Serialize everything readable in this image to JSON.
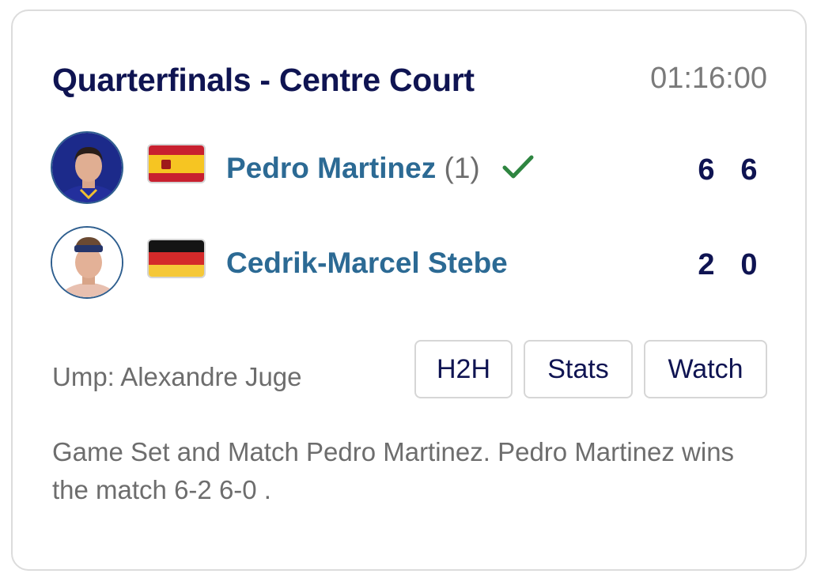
{
  "match": {
    "title": "Quarterfinals - Centre Court",
    "duration": "01:16:00",
    "umpire": "Ump: Alexandre Juge",
    "summary": "Game Set and Match Pedro Martinez. Pedro Martinez wins the match 6-2 6-0 ."
  },
  "players": [
    {
      "name": "Pedro Martinez",
      "seed": "(1)",
      "country_flag": "spain-flag",
      "winner": true,
      "winner_icon": "check-icon",
      "sets": [
        "6",
        "6"
      ]
    },
    {
      "name": "Cedrik-Marcel Stebe",
      "country_flag": "germany-flag",
      "winner": false,
      "sets": [
        "2",
        "0"
      ]
    }
  ],
  "actions": {
    "h2h": "H2H",
    "stats": "Stats",
    "watch": "Watch"
  },
  "colors": {
    "title": "#0f1452",
    "player_name": "#2c6a94",
    "muted_text": "#6d6d6d",
    "check": "#2e8540",
    "border": "#dcdcdc"
  }
}
